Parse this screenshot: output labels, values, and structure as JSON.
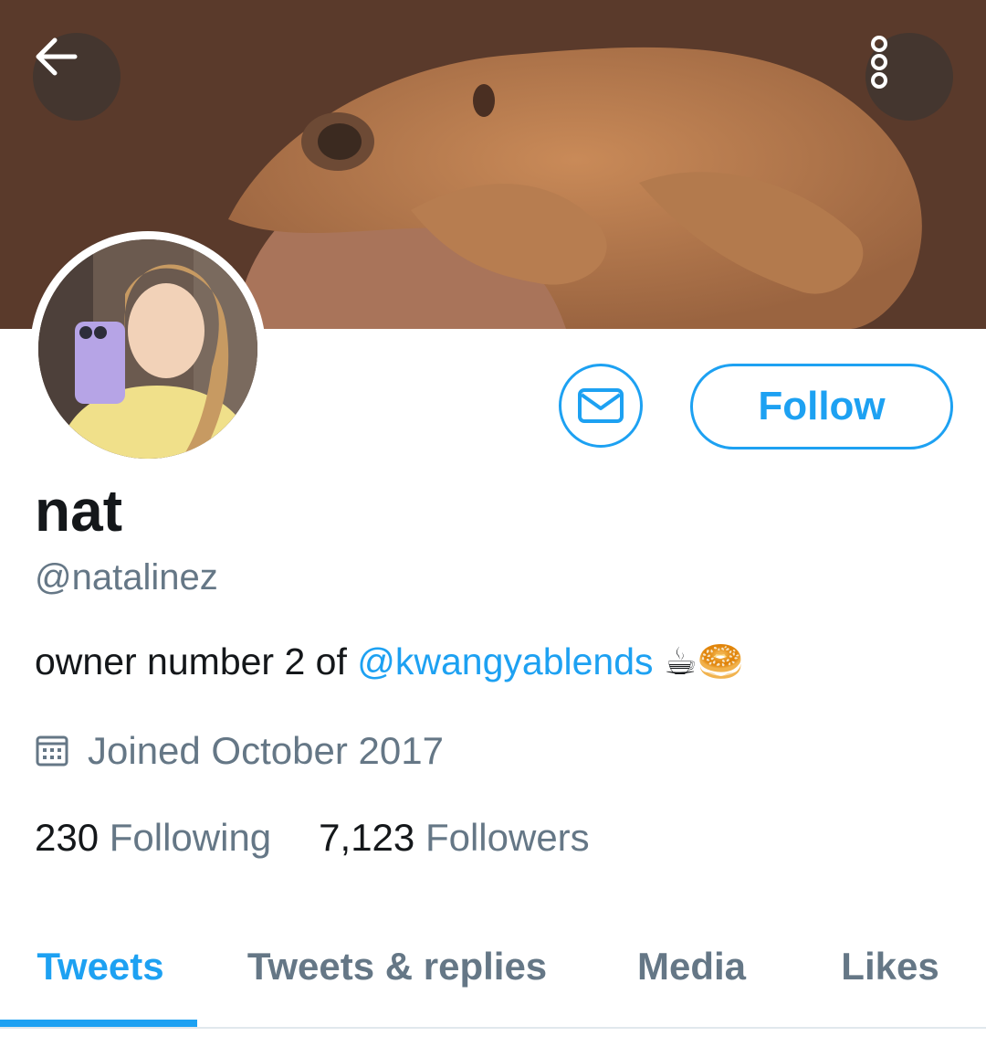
{
  "header": {
    "back_icon": "arrow-left-icon",
    "more_icon": "more-vertical-icon"
  },
  "profile": {
    "display_name": "nat",
    "handle": "@natalinez",
    "bio_prefix": "owner number 2 of ",
    "bio_mention": "@kwangyablends",
    "bio_emoji": "☕🥯",
    "joined": "Joined October 2017",
    "follow_label": "Follow"
  },
  "stats": {
    "following_count": "230",
    "following_label": "Following",
    "followers_count": "7,123",
    "followers_label": "Followers"
  },
  "tabs": [
    {
      "label": "Tweets",
      "active": true
    },
    {
      "label": "Tweets & replies",
      "active": false
    },
    {
      "label": "Media",
      "active": false
    },
    {
      "label": "Likes",
      "active": false
    }
  ],
  "colors": {
    "accent": "#1da1f2",
    "text_primary": "#14171a",
    "text_secondary": "#657786"
  }
}
